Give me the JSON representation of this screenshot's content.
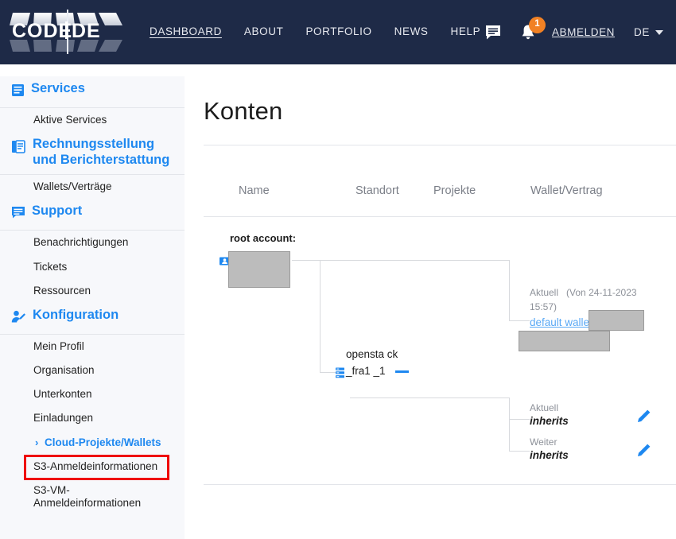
{
  "header": {
    "logo_text": "CODE|DE",
    "nav": [
      {
        "label": "DASHBOARD",
        "active": true
      },
      {
        "label": "ABOUT",
        "active": false
      },
      {
        "label": "PORTFOLIO",
        "active": false
      },
      {
        "label": "NEWS",
        "active": false
      },
      {
        "label": "HELP",
        "active": false
      }
    ],
    "chat_icon": "chat-icon",
    "bell_icon": "bell-icon",
    "notification_count": "1",
    "logout_label": "ABMELDEN",
    "language": "DE",
    "accent_orange": "#f18124",
    "header_bg": "#1e2a47"
  },
  "sidebar": {
    "sections": [
      {
        "title": "Services",
        "icon": "list-box-icon",
        "items": [
          {
            "label": "Aktive Services"
          }
        ]
      },
      {
        "title": "Rechnungsstellung und Berichterstattung",
        "icon": "documents-icon",
        "items": [
          {
            "label": "Wallets/Verträge"
          }
        ]
      },
      {
        "title": "Support",
        "icon": "chat-box-icon",
        "items": [
          {
            "label": "Benachrichtigungen"
          },
          {
            "label": "Tickets"
          },
          {
            "label": "Ressourcen"
          }
        ]
      },
      {
        "title": "Konfiguration",
        "icon": "user-edit-icon",
        "items": [
          {
            "label": "Mein Profil"
          },
          {
            "label": "Organisation"
          },
          {
            "label": "Unterkonten"
          },
          {
            "label": "Einladungen"
          },
          {
            "label": "Cloud-Projekte/Wallets",
            "highlighted": true,
            "chevron": "›"
          },
          {
            "label": "S3-Anmeldeinformationen"
          },
          {
            "label": "S3-VM-Anmeldeinformationen"
          }
        ]
      }
    ],
    "highlight_color": "#ef0000",
    "link_color": "#1e88f0"
  },
  "main": {
    "page_title": "Konten",
    "columns": {
      "name": "Name",
      "standort": "Standort",
      "projekte": "Projekte",
      "wallet": "Wallet/Vertrag"
    },
    "tree": {
      "root": {
        "label": "root account:",
        "value_redacted": true,
        "icon": "account-icon"
      },
      "child": {
        "name": "opensta ck_fra1 _1",
        "icon": "server-stack-icon",
        "collapse_icon": "minus-icon"
      }
    },
    "wallet_root": {
      "status_label": "Aktuell",
      "status_date": "(Von 24-11-2023",
      "status_time": "15:57)",
      "wallet_link": "default wallet:",
      "value_redacted": true
    },
    "wallet_child": {
      "rows": [
        {
          "label": "Aktuell",
          "value": "inherits",
          "edit_icon": "pencil-icon"
        },
        {
          "label": "Weiter",
          "value": "inherits",
          "edit_icon": "pencil-icon"
        }
      ]
    }
  }
}
